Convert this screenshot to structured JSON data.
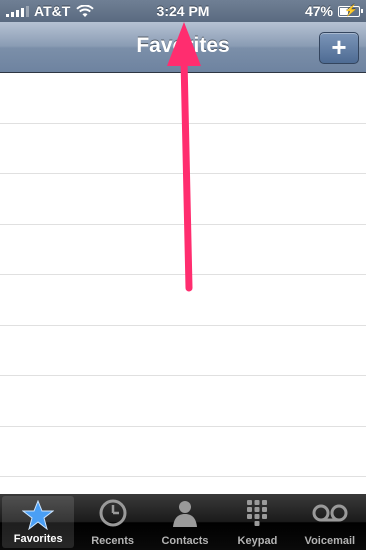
{
  "status_bar": {
    "carrier": "AT&T",
    "time": "3:24 PM",
    "battery_percent_text": "47%",
    "battery_level": 0.47
  },
  "nav_bar": {
    "title": "Favorites",
    "add_button_label": "+"
  },
  "favorites": {
    "rows": 8
  },
  "tab_bar": {
    "tabs": [
      {
        "label": "Favorites",
        "icon": "star-icon",
        "selected": true
      },
      {
        "label": "Recents",
        "icon": "clock-icon",
        "selected": false
      },
      {
        "label": "Contacts",
        "icon": "person-icon",
        "selected": false
      },
      {
        "label": "Keypad",
        "icon": "keypad-icon",
        "selected": false
      },
      {
        "label": "Voicemail",
        "icon": "voicemail-icon",
        "selected": false
      }
    ]
  },
  "annotation": {
    "arrow_color": "#ff2d6f"
  },
  "colors": {
    "selected_tab": "#4a9ff5"
  }
}
